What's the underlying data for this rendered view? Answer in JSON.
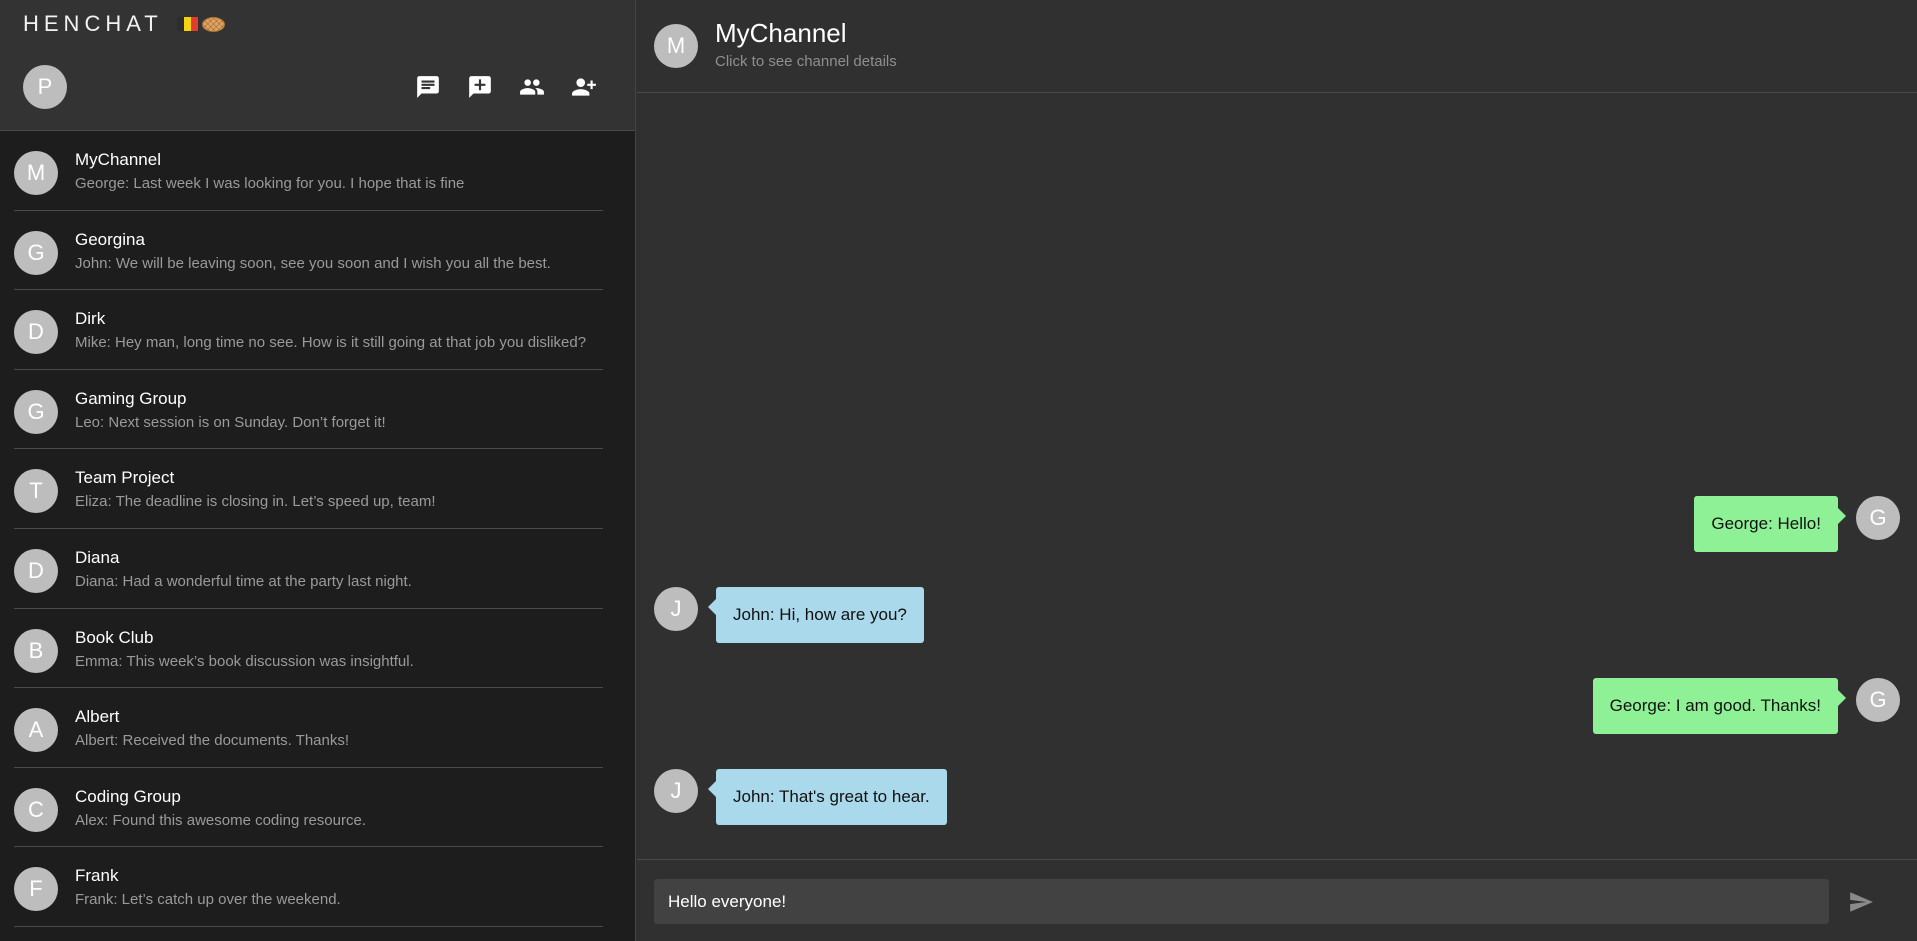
{
  "app": {
    "brand": "HENCHAT",
    "flag_colors": [
      "#2d2d2d",
      "#f6d312",
      "#e33b2e"
    ]
  },
  "user": {
    "avatar_letter": "P"
  },
  "header_actions": [
    {
      "name": "chat-icon"
    },
    {
      "name": "add-chat-icon"
    },
    {
      "name": "group-icon"
    },
    {
      "name": "add-contact-icon"
    }
  ],
  "chats": [
    {
      "letter": "M",
      "name": "MyChannel",
      "preview": "George: Last week I was looking for you. I hope that is fine"
    },
    {
      "letter": "G",
      "name": "Georgina",
      "preview": "John: We will be leaving soon, see you soon and I wish you all the best."
    },
    {
      "letter": "D",
      "name": "Dirk",
      "preview": "Mike: Hey man, long time no see. How is it still going at that job you disliked?"
    },
    {
      "letter": "G",
      "name": "Gaming Group",
      "preview": "Leo: Next session is on Sunday. Don’t forget it!"
    },
    {
      "letter": "T",
      "name": "Team Project",
      "preview": "Eliza: The deadline is closing in. Let’s speed up, team!"
    },
    {
      "letter": "D",
      "name": "Diana",
      "preview": "Diana: Had a wonderful time at the party last night."
    },
    {
      "letter": "B",
      "name": "Book Club",
      "preview": "Emma: This week’s book discussion was insightful."
    },
    {
      "letter": "A",
      "name": "Albert",
      "preview": "Albert: Received the documents. Thanks!"
    },
    {
      "letter": "C",
      "name": "Coding Group",
      "preview": "Alex: Found this awesome coding resource."
    },
    {
      "letter": "F",
      "name": "Frank",
      "preview": "Frank: Let’s catch up over the weekend."
    }
  ],
  "channel": {
    "avatar_letter": "M",
    "title": "MyChannel",
    "subtitle": "Click to see channel details"
  },
  "messages": [
    {
      "direction": "out",
      "letter": "G",
      "text": "George: Hello!"
    },
    {
      "direction": "in",
      "letter": "J",
      "text": "John: Hi, how are you?"
    },
    {
      "direction": "out",
      "letter": "G",
      "text": "George: I am good. Thanks!"
    },
    {
      "direction": "in",
      "letter": "J",
      "text": "John: That's great to hear."
    }
  ],
  "composer": {
    "value": "Hello everyone!"
  },
  "colors": {
    "outgoing_bubble": "#8ff195",
    "incoming_bubble": "#a9d9ea",
    "avatar": "#bdbdbd"
  }
}
